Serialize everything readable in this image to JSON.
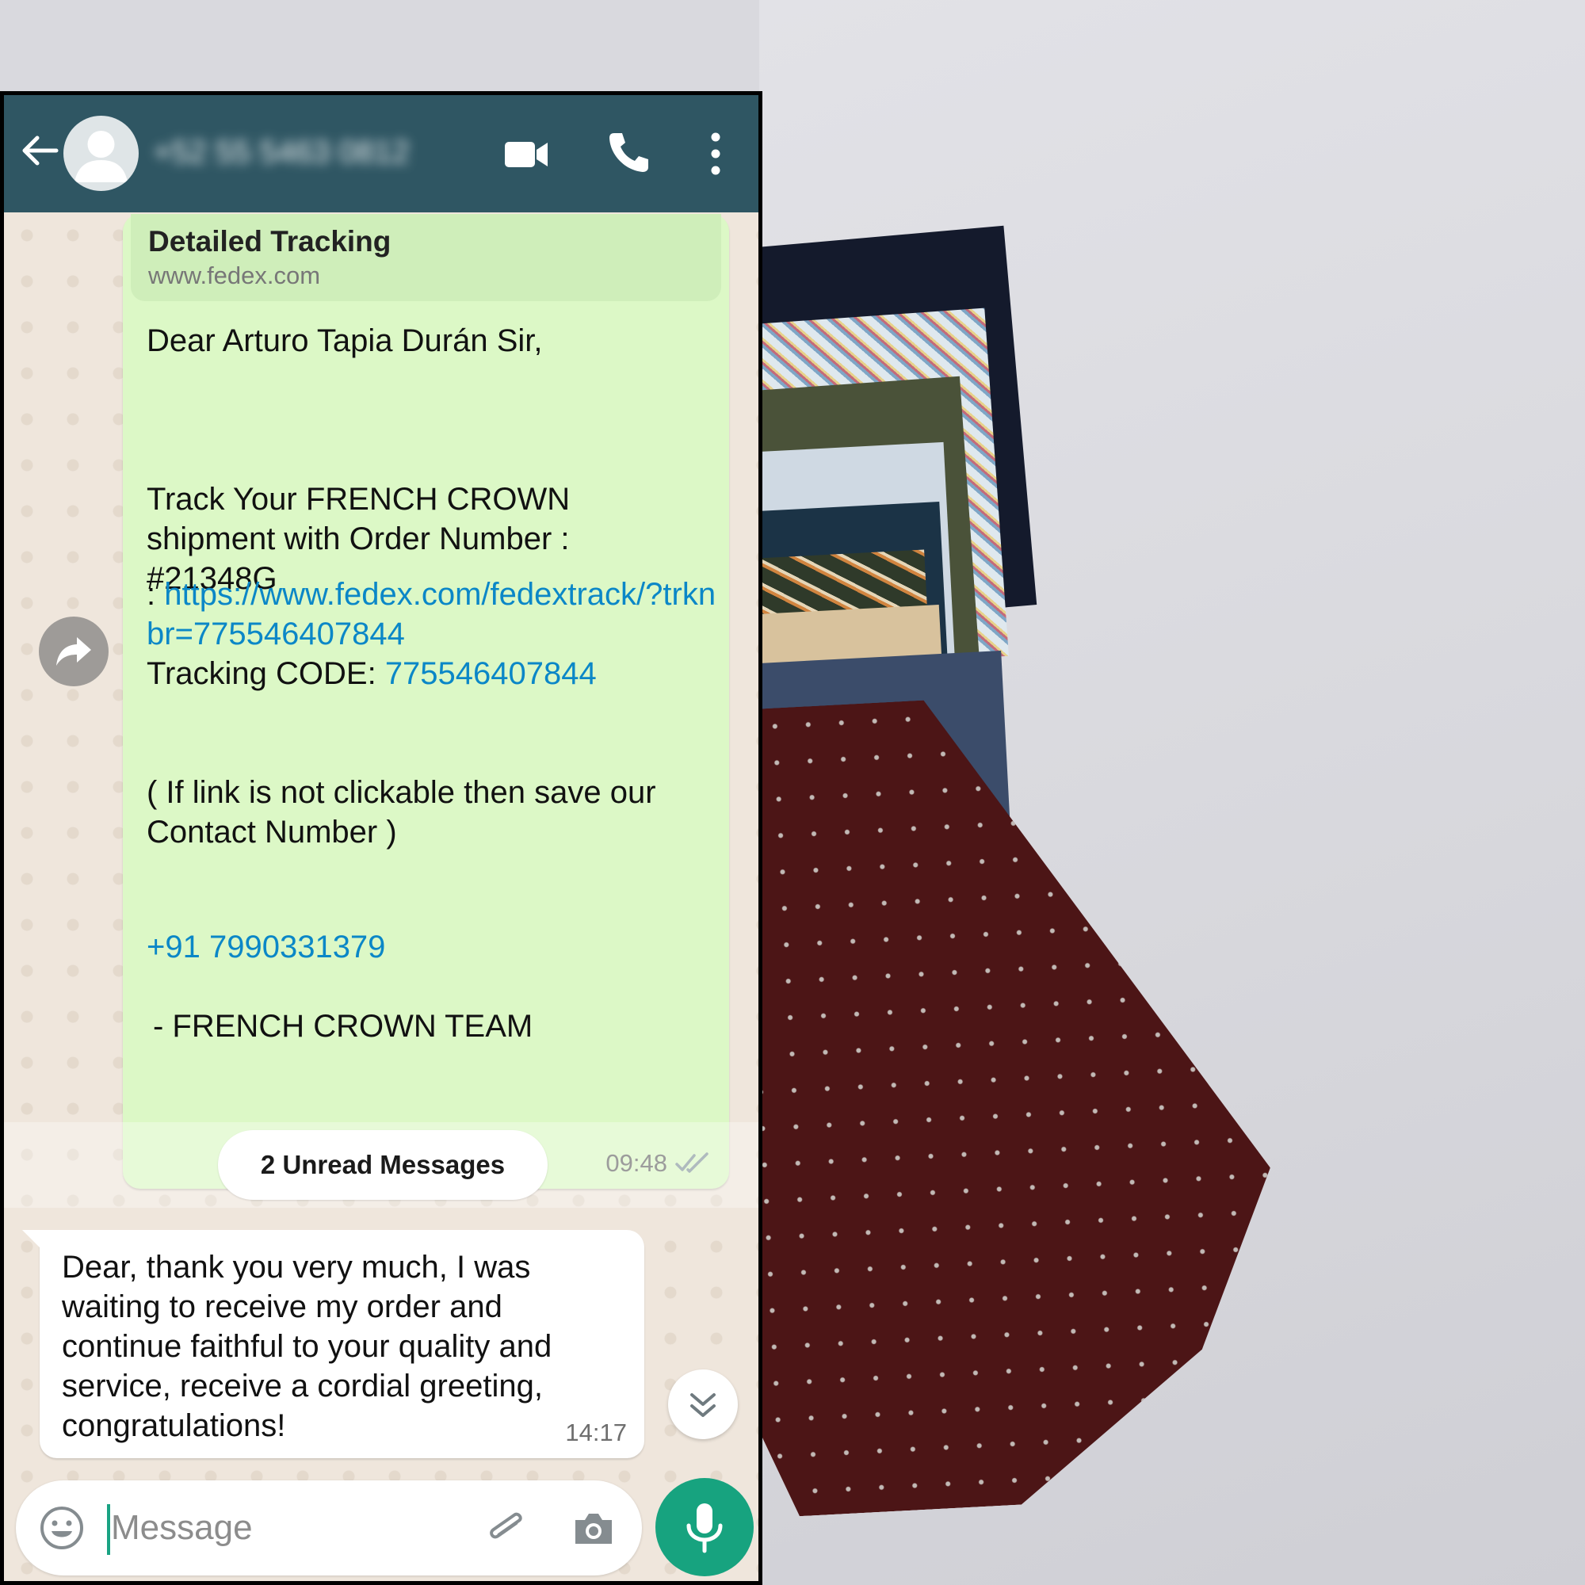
{
  "header": {
    "contact_name": "+52 55 5463 0812",
    "video_label": "video-call",
    "call_label": "voice-call",
    "menu_label": "more-options"
  },
  "link_preview": {
    "title": "Detailed Tracking",
    "url": "www.fedex.com"
  },
  "outgoing_message": {
    "greeting": "Dear Arturo Tapia Durán Sir,",
    "body_line": "Track Your FRENCH CROWN shipment with Order Number : #21348G",
    "link_prefix": ": ",
    "link": "https://www.fedex.com/fedextrack/?trknbr=775546407844",
    "tracking_label": "Tracking CODE: ",
    "tracking_code": "775546407844",
    "note": "( If link is not clickable then save our Contact Number )",
    "phone": "+91 7990331379",
    "signature": "- FRENCH CROWN TEAM",
    "time": "09:48",
    "status_icon": "double-check-icon"
  },
  "unread": {
    "label": "2 Unread Messages"
  },
  "incoming_message": {
    "text": "Dear, thank you very much, I was waiting to receive my order and continue faithful to your quality and service, receive a cordial greeting, congratulations!",
    "time": "14:17"
  },
  "composer": {
    "placeholder": "Message"
  },
  "colors": {
    "header": "#2f5663",
    "outgoing_bubble": "#dcf8c6",
    "link": "#0b87c7",
    "mic_button": "#17a37f"
  }
}
